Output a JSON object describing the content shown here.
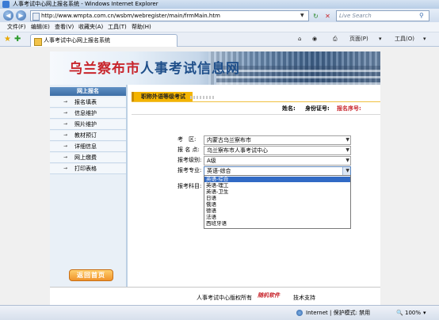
{
  "window": {
    "title": "人事考试中心网上报名系统 - Windows Internet Explorer"
  },
  "addressbar": {
    "url": "http://www.wmpta.com.cn/wsbm/webregister/main/frmMain.htm",
    "search_placeholder": "Live Search"
  },
  "menubar": {
    "items": [
      "文件(F)",
      "编辑(E)",
      "查看(V)",
      "收藏夹(A)",
      "工具(T)",
      "帮助(H)"
    ]
  },
  "tab": {
    "title": "人事考试中心网上报名系统"
  },
  "toolbar_right": {
    "page_label": "页面(P)",
    "tools_label": "工具(O)"
  },
  "banner": {
    "title_part1": "乌兰察布市",
    "title_part2": "人事考试信息网"
  },
  "sidebar": {
    "header": "网上报名",
    "items": [
      "报名填表",
      "信息维护",
      "照片维护",
      "教材预订",
      "详细信息",
      "网上缴费",
      "打印表格"
    ],
    "back_button": "返回首页"
  },
  "page": {
    "title": "职称外语等级考试",
    "name_label": "姓名:",
    "id_label": "身份证号:",
    "regno_label": "报名序号:"
  },
  "form": {
    "exam_area_label": "考　区:",
    "exam_area_value": "内蒙古乌兰察布市",
    "reg_point_label": "报 名 点:",
    "reg_point_value": "乌兰察布市人事考试中心",
    "level_label": "报考级别:",
    "level_value": "A级",
    "major_label": "报考专业:",
    "major_value": "英语-综合",
    "subject_label": "报考科目:"
  },
  "dropdown": {
    "options": [
      "英语-综合",
      "英语-理工",
      "英语-卫生",
      "日语",
      "俄语",
      "德语",
      "法语",
      "西班牙语"
    ],
    "selected_index": 0
  },
  "footer": {
    "copyright": "人事考试中心版权所有",
    "brand": "随机软件",
    "support": "技术支持"
  },
  "statusbar": {
    "zone": "Internet | 保护模式: 禁用",
    "zoom": "100%"
  }
}
